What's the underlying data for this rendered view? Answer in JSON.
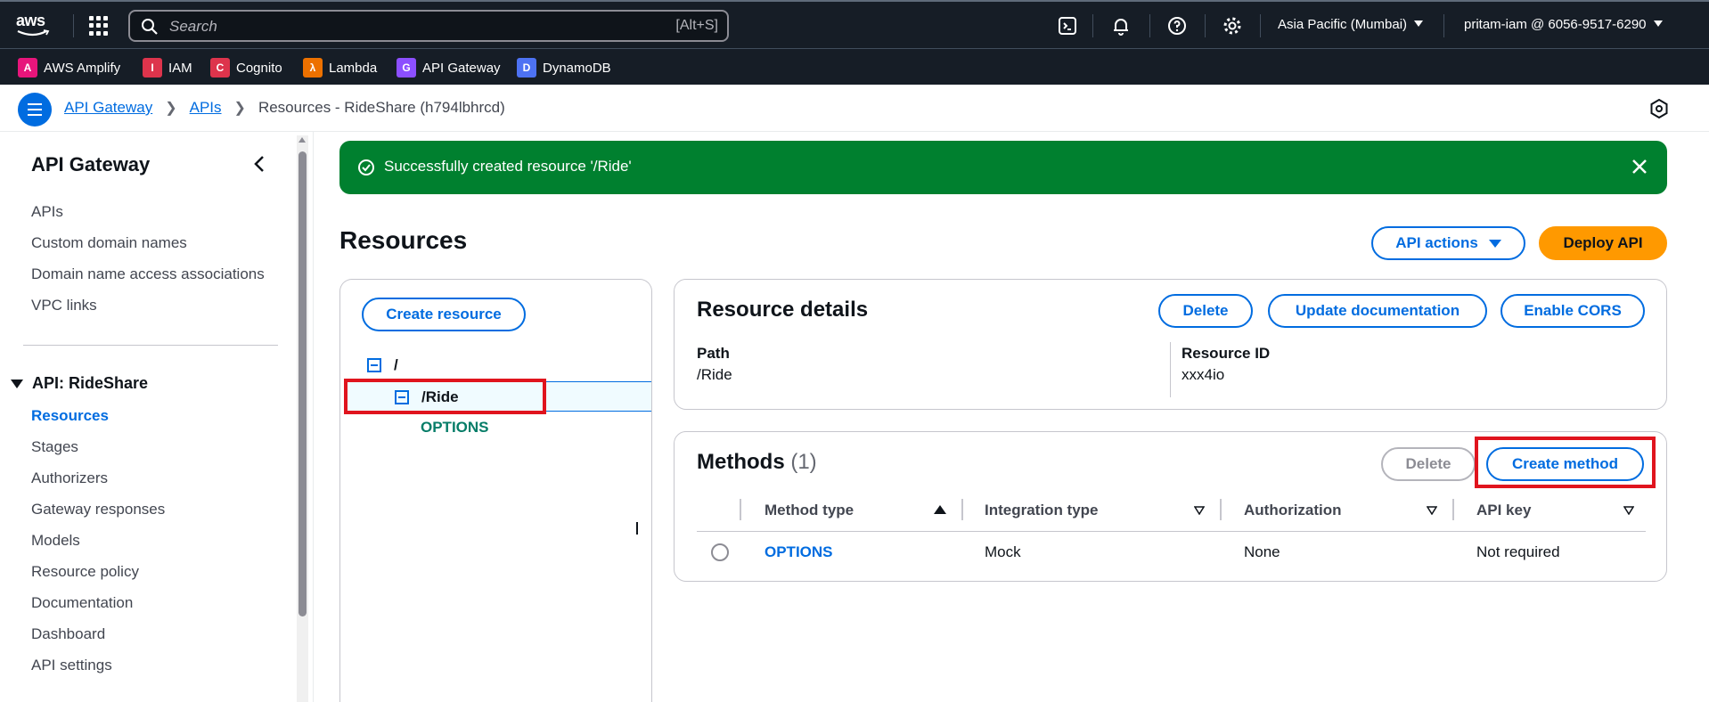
{
  "topnav": {
    "logo": "aws",
    "search_placeholder": "Search",
    "search_shortcut": "[Alt+S]",
    "region": "Asia Pacific (Mumbai)",
    "account": "pritam-iam @ 6056-9517-6290"
  },
  "favorites": [
    {
      "label": "AWS Amplify",
      "color": "#e7157b"
    },
    {
      "label": "IAM",
      "color": "#dd344c"
    },
    {
      "label": "Cognito",
      "color": "#dd344c"
    },
    {
      "label": "Lambda",
      "color": "#ed7100"
    },
    {
      "label": "API Gateway",
      "color": "#8c4fff"
    },
    {
      "label": "DynamoDB",
      "color": "#4d72f3"
    }
  ],
  "breadcrumb": {
    "items": [
      "API Gateway",
      "APIs"
    ],
    "current": "Resources - RideShare (h794lbhrcd)"
  },
  "sidenav": {
    "title": "API Gateway",
    "top_items": [
      "APIs",
      "Custom domain names",
      "Domain name access associations",
      "VPC links"
    ],
    "section_title": "API: RideShare",
    "section_items": [
      "Resources",
      "Stages",
      "Authorizers",
      "Gateway responses",
      "Models",
      "Resource policy",
      "Documentation",
      "Dashboard",
      "API settings"
    ],
    "active": "Resources"
  },
  "flash": {
    "message": "Successfully created resource '/Ride'"
  },
  "page": {
    "title": "Resources",
    "api_actions_label": "API actions",
    "deploy_label": "Deploy API"
  },
  "tree": {
    "create_resource_label": "Create resource",
    "root": "/",
    "child": "/Ride",
    "method": "OPTIONS"
  },
  "resource_details": {
    "title": "Resource details",
    "delete_label": "Delete",
    "update_doc_label": "Update documentation",
    "enable_cors_label": "Enable CORS",
    "path_label": "Path",
    "path_value": "/Ride",
    "resource_id_label": "Resource ID",
    "resource_id_value": "xxx4io"
  },
  "methods": {
    "title": "Methods",
    "count": "(1)",
    "delete_label": "Delete",
    "create_label": "Create method",
    "columns": [
      "Method type",
      "Integration type",
      "Authorization",
      "API key"
    ],
    "rows": [
      {
        "method_type": "OPTIONS",
        "integration_type": "Mock",
        "authorization": "None",
        "api_key": "Not required"
      }
    ]
  }
}
